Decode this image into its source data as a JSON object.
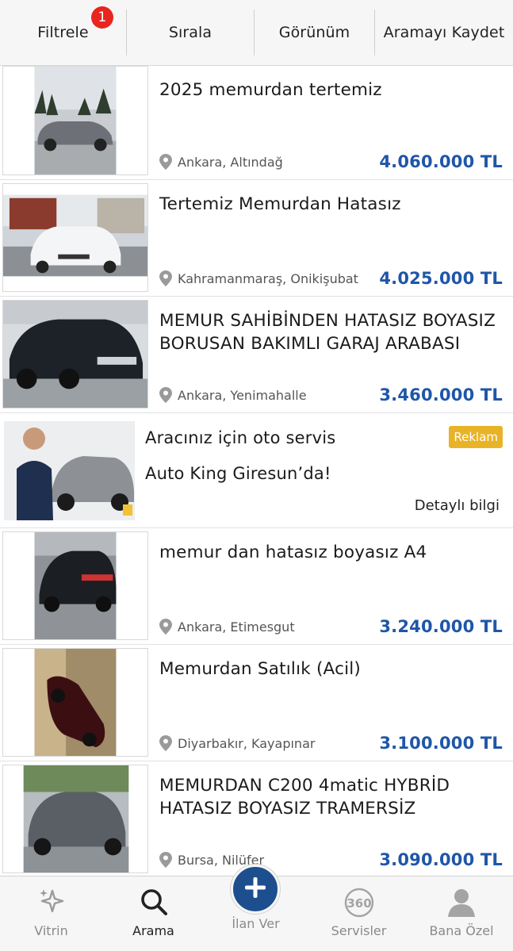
{
  "toolbar": {
    "filter_label": "Filtrele",
    "filter_badge": "1",
    "sort_label": "Sırala",
    "view_label": "Görünüm",
    "save_search_label": "Aramayı Kaydet"
  },
  "listings": [
    {
      "title": "2025 memurdan tertemiz",
      "location": "Ankara, Altındağ",
      "price": "4.060.000 TL"
    },
    {
      "title": "Tertemiz Memurdan Hatasız",
      "location": "Kahramanmaraş, Onikişubat",
      "price": "4.025.000 TL"
    },
    {
      "title": "MEMUR SAHİBİNDEN HATASIZ BOYASIZ BORUSAN BAKIMLI GARAJ ARABASI",
      "location": "Ankara, Yenimahalle",
      "price": "3.460.000 TL"
    },
    {
      "title": "memur dan hatasız boyasız A4",
      "location": "Ankara, Etimesgut",
      "price": "3.240.000 TL"
    },
    {
      "title": "Memurdan Satılık (Acil)",
      "location": "Diyarbakır, Kayapınar",
      "price": "3.100.000 TL"
    },
    {
      "title": "MEMURDAN C200 4matic HYBRİD HATASIZ BOYASIZ TRAMERSİZ",
      "location": "Bursa, Nilüfer",
      "price": "3.090.000 TL"
    }
  ],
  "ad": {
    "line1": "Aracınız için oto servis",
    "line2": "Auto King Giresun’da!",
    "badge": "Reklam",
    "more": "Detaylı bilgi"
  },
  "tabbar": {
    "items": [
      {
        "label": "Vitrin",
        "icon": "sparkle-icon"
      },
      {
        "label": "Arama",
        "icon": "search-icon"
      },
      {
        "label": "İlan Ver",
        "icon": "plus-icon"
      },
      {
        "label": "Servisler",
        "icon": "360-icon"
      },
      {
        "label": "Bana Özel",
        "icon": "person-icon"
      }
    ],
    "active": "Arama"
  },
  "colors": {
    "price": "#1f56a8",
    "badge": "#e8251f",
    "ad_badge": "#e9b328",
    "fab": "#1d4f8f"
  }
}
